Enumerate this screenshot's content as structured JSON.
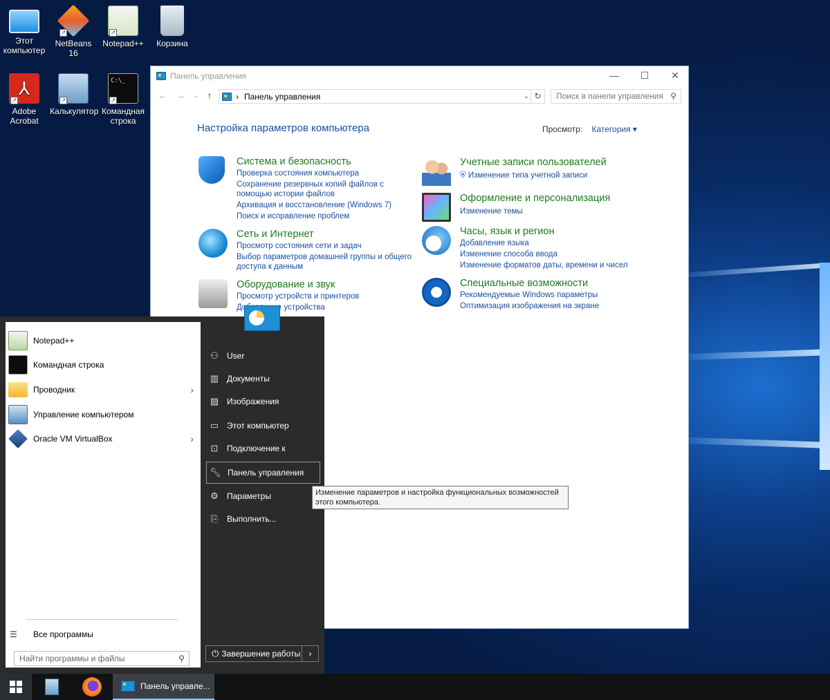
{
  "desktop": {
    "icons": [
      {
        "label": "Этот компьютер"
      },
      {
        "label": "NetBeans 16"
      },
      {
        "label": "Notepad++"
      },
      {
        "label": "Корзина"
      },
      {
        "label": "Adobe Acrobat"
      },
      {
        "label": "Калькулятор"
      },
      {
        "label": "Командная строка"
      }
    ]
  },
  "window": {
    "title": "Панель управления",
    "address": "Панель управления",
    "search_placeholder": "Поиск в панели управления",
    "heading": "Настройка параметров компьютера",
    "view_by_label": "Просмотр:",
    "view_by_value": "Категория",
    "categories": [
      {
        "title": "Система и безопасность",
        "links": [
          "Проверка состояния компьютера",
          "Сохранение резервных копий файлов с",
          "помощью истории файлов",
          "Архивация и восстановление (Windows 7)",
          "Поиск и исправление проблем"
        ]
      },
      {
        "title": "Сеть и Интернет",
        "links": [
          "Просмотр состояния сети и задач",
          "Выбор параметров домашней группы и общего",
          "доступа к данным"
        ]
      },
      {
        "title": "Оборудование и звук",
        "links": [
          "Просмотр устройств и принтеров",
          "Добавление устройства"
        ]
      },
      {
        "title": "Учетные записи пользователей",
        "links": [
          "Изменение типа учетной записи"
        ]
      },
      {
        "title": "Оформление и персонализация",
        "links": [
          "Изменение темы"
        ]
      },
      {
        "title": "Часы, язык и регион",
        "links": [
          "Добавление языка",
          "Изменение способа ввода",
          "Изменение форматов даты, времени и чисел"
        ]
      },
      {
        "title": "Специальные возможности",
        "links": [
          "Рекомендуемые Windows параметры",
          "Оптимизация изображения на экране"
        ]
      }
    ]
  },
  "start_menu": {
    "programs": [
      "Notepad++",
      "Командная строка",
      "Проводник",
      "Управление компьютером",
      "Oracle VM VirtualBox"
    ],
    "all_programs": "Все программы",
    "search_placeholder": "Найти программы и файлы",
    "places": [
      "User",
      "Документы",
      "Изображения",
      "Этот компьютер",
      "Подключение к",
      "Панель управления",
      "Параметры",
      "Выполнить..."
    ],
    "shutdown": "Завершение работы",
    "tooltip": "Изменение параметров и настройка функциональных возможностей этого компьютера."
  },
  "taskbar": {
    "active_window": "Панель управле..."
  },
  "colors": {
    "link": "#1a4fa0",
    "category_title": "#1f7a1f",
    "desktop_bg": "#082a63"
  }
}
